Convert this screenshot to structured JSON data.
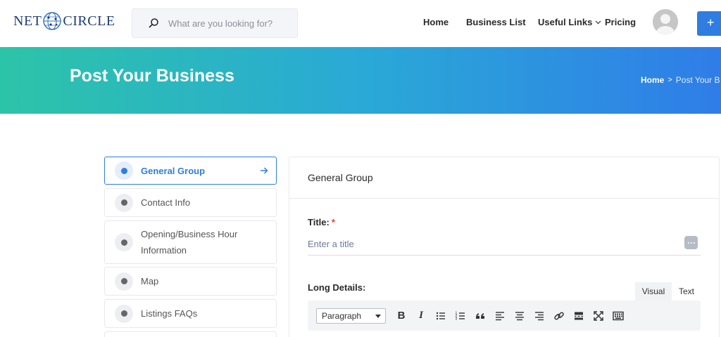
{
  "header": {
    "logo": {
      "left_text": "NET",
      "right_text": "CIRCLE"
    },
    "search": {
      "placeholder": "What are you looking for?",
      "icon": "search-icon"
    },
    "nav": [
      {
        "label": "Home"
      },
      {
        "label": "Business List"
      },
      {
        "label": "Useful Links",
        "icon": "chevron-down-icon"
      },
      {
        "label": "Pricing"
      }
    ],
    "add_button_label": "+"
  },
  "banner": {
    "title": "Post Your Business",
    "breadcrumb": {
      "home": "Home",
      "separator": ">",
      "current": "Post Your B"
    }
  },
  "steps": [
    {
      "label": "General Group",
      "active": true
    },
    {
      "label": "Contact Info",
      "active": false
    },
    {
      "label": "Opening/Business Hour Information",
      "active": false
    },
    {
      "label": "Map",
      "active": false
    },
    {
      "label": "Listings FAQs",
      "active": false
    }
  ],
  "form": {
    "panel_title": "General Group",
    "title_field": {
      "label": "Title:",
      "required_mark": "*",
      "placeholder": "Enter a title",
      "value": ""
    },
    "long_details": {
      "label": "Long Details:",
      "tabs": [
        {
          "label": "Visual",
          "selected": true
        },
        {
          "label": "Text",
          "selected": false
        }
      ],
      "format_select": "Paragraph",
      "toolbar_icons": [
        "bold-icon",
        "italic-icon",
        "bullet-list-icon",
        "numbered-list-icon",
        "blockquote-icon",
        "align-left-icon",
        "align-center-icon",
        "align-right-icon",
        "link-icon",
        "read-more-icon",
        "fullscreen-icon",
        "keyboard-icon"
      ],
      "bold_glyph": "B",
      "italic_glyph": "I"
    }
  },
  "colors": {
    "accent": "#2f7de1",
    "banner_start": "#2cc4a8",
    "banner_end": "#2f7de8",
    "required": "#e53935"
  }
}
